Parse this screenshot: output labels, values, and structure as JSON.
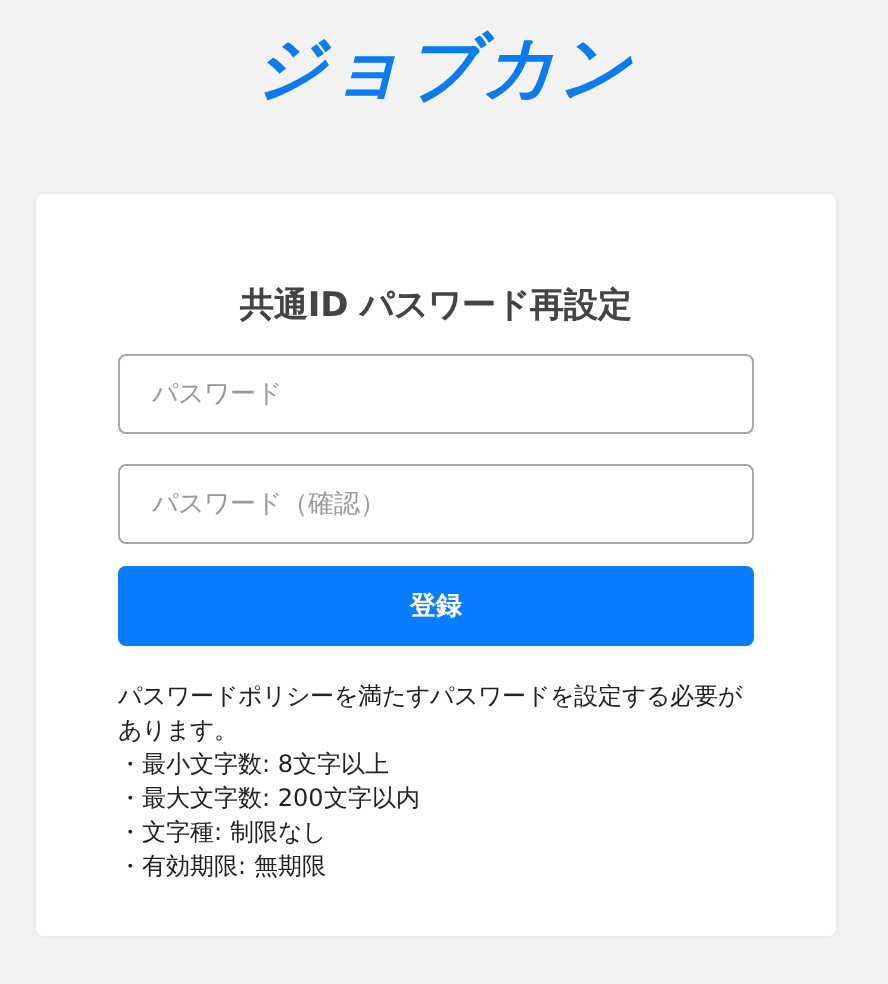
{
  "logo": "ジョブカン",
  "form": {
    "title": "共通ID パスワード再設定",
    "fields": [
      {
        "placeholder": "パスワード"
      },
      {
        "placeholder": "パスワード（確認）"
      }
    ],
    "submit_button": "登録",
    "policy_text": "パスワードポリシーを満たすパスワードを設定する必要があります。",
    "policy_items": [
      "・最小文字数: 8文字以上",
      "・最大文字数: 200文字以内",
      "・文字種: 制限なし",
      "・有効期限: 無期限"
    ]
  }
}
